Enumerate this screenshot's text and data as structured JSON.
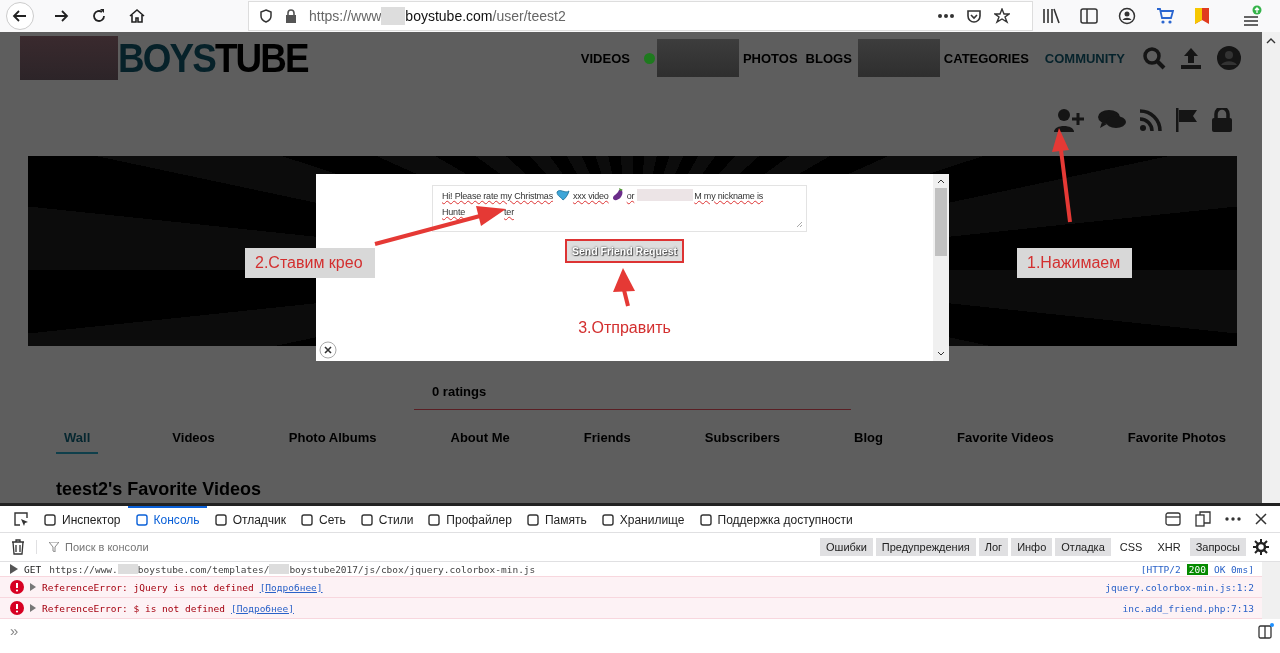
{
  "browser": {
    "url_parts": [
      {
        "kind": "dim",
        "text": "https://www"
      },
      {
        "kind": "redacted"
      },
      {
        "kind": "host",
        "text": "boystube.com"
      },
      {
        "kind": "dim",
        "text": "/user/teest2"
      }
    ]
  },
  "site": {
    "logo": [
      "BOYS",
      "TUBE"
    ],
    "nav": [
      {
        "kind": "link",
        "label": "VIDEOS",
        "selected": false
      },
      {
        "kind": "redacted",
        "dot": true
      },
      {
        "kind": "link",
        "label": "PHOTOS",
        "selected": false
      },
      {
        "kind": "link",
        "label": "BLOGS",
        "selected": false
      },
      {
        "kind": "redacted",
        "dot": false
      },
      {
        "kind": "link",
        "label": "CATEGORIES",
        "selected": false
      },
      {
        "kind": "link",
        "label": "COMMUNITY",
        "selected": true
      }
    ],
    "ratings": "0 ratings",
    "tabs": [
      {
        "label": "Wall",
        "selected": true
      },
      {
        "label": "Videos",
        "selected": false
      },
      {
        "label": "Photo Albums",
        "selected": false
      },
      {
        "label": "About Me",
        "selected": false
      },
      {
        "label": "Friends",
        "selected": false
      },
      {
        "label": "Subscribers",
        "selected": false
      },
      {
        "label": "Blog",
        "selected": false
      },
      {
        "label": "Favorite Videos",
        "selected": false
      },
      {
        "label": "Favorite Photos",
        "selected": false
      }
    ],
    "section_title": "teest2's Favorite Videos"
  },
  "dialog": {
    "message_lines": [
      [
        {
          "kind": "text",
          "text": "Hi! Please rate my Christmas"
        },
        {
          "kind": "ribbon-emoji"
        },
        {
          "kind": "text",
          "text": "xxx video"
        },
        {
          "kind": "eggplant-emoji"
        },
        {
          "kind": "text",
          "text": "or"
        },
        {
          "kind": "redacted"
        },
        {
          "kind": "text",
          "text": "M my nickname is"
        }
      ],
      [
        {
          "kind": "text",
          "text": "Hunte"
        },
        {
          "kind": "hidden"
        },
        {
          "kind": "text",
          "text": "ter"
        }
      ]
    ],
    "button": "Send Friend Request",
    "hint": "3.Отправить"
  },
  "annotations": [
    {
      "text": "2.Ставим крео"
    },
    {
      "text": "1.Нажимаем"
    }
  ],
  "devtools": {
    "tabs": [
      {
        "label": "Инспектор",
        "selected": false
      },
      {
        "label": "Консоль",
        "selected": true
      },
      {
        "label": "Отладчик",
        "selected": false
      },
      {
        "label": "Сеть",
        "selected": false
      },
      {
        "label": "Стили",
        "selected": false
      },
      {
        "label": "Профайлер",
        "selected": false
      },
      {
        "label": "Память",
        "selected": false
      },
      {
        "label": "Хранилище",
        "selected": false
      },
      {
        "label": "Поддержка доступности",
        "selected": false
      }
    ],
    "filter_placeholder": "Поиск в консоли",
    "filters": [
      {
        "label": "Ошибки",
        "on": true
      },
      {
        "label": "Предупреждения",
        "on": true
      },
      {
        "label": "Лог",
        "on": true
      },
      {
        "label": "Инфо",
        "on": true
      },
      {
        "label": "Отладка",
        "on": true
      },
      {
        "label": "CSS",
        "on": false
      },
      {
        "label": "XHR",
        "on": false
      },
      {
        "label": "Запросы",
        "on": true
      }
    ],
    "request": {
      "method": "GET",
      "url_parts": [
        {
          "kind": "text",
          "text": "https://www."
        },
        {
          "kind": "redacted"
        },
        {
          "kind": "text",
          "text": "boystube.com/templates/"
        },
        {
          "kind": "redacted"
        },
        {
          "kind": "text",
          "text": "boystube2017/js/cbox/jquery.colorbox-min.js"
        }
      ],
      "protocol": "[HTTP/2",
      "status": "200",
      "result": "OK 0ms]"
    },
    "errors": [
      {
        "message": "ReferenceError: jQuery is not defined",
        "link": "[Подробнее]",
        "source": "jquery.colorbox-min.js:1:2"
      },
      {
        "message": "ReferenceError: $ is not defined",
        "link": "[Подробнее]",
        "source": "inc.add_friend.php:7:13"
      }
    ],
    "prompt": "»"
  }
}
